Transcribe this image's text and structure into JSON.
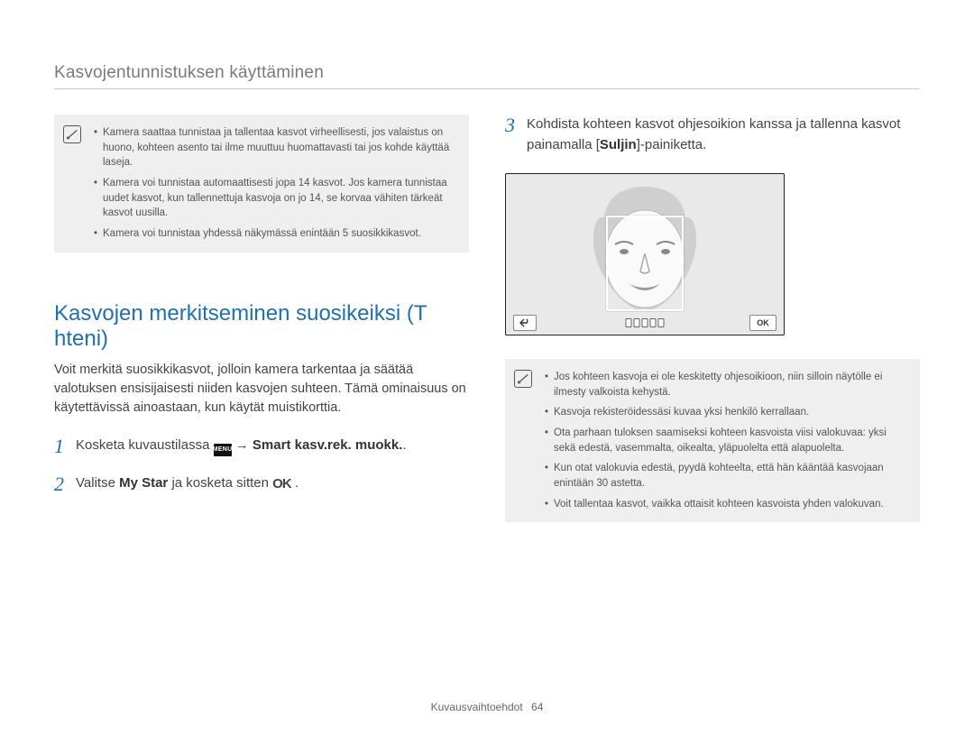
{
  "header": "Kasvojentunnistuksen käyttäminen",
  "notesTop": [
    "Kamera saattaa tunnistaa ja tallentaa kasvot virheellisesti, jos valaistus on huono, kohteen asento tai ilme muuttuu huomattavasti tai jos kohde käyttää laseja.",
    "Kamera voi tunnistaa automaattisesti jopa 14 kasvot. Jos kamera tunnistaa uudet kasvot, kun tallennettuja kasvoja on jo 14, se korvaa vähiten tärkeät kasvot uusilla.",
    "Kamera voi tunnistaa yhdessä näkymässä enintään 5 suosikkikasvot."
  ],
  "section": {
    "title": "Kasvojen merkitseminen suosikeiksi (T  hteni)",
    "intro": "Voit merkitä suosikkikasvot, jolloin kamera tarkentaa ja säätää valotuksen ensisijaisesti niiden kasvojen suhteen. Tämä ominaisuus on käytettävissä ainoastaan, kun käytät muistikorttia."
  },
  "steps": {
    "s1": {
      "num": "1",
      "pre": "Kosketa kuvaustilassa ",
      "menu": "MENU",
      "arrow": " → ",
      "bold": "Smart kasv.rek. muokk.",
      "post": "."
    },
    "s2": {
      "num": "2",
      "pre": "Valitse ",
      "bold": "My Star",
      "mid": " ja kosketa sitten ",
      "icon": "OK",
      "post": "."
    },
    "s3": {
      "num": "3",
      "pre": "Kohdista kohteen kasvot ohjesoikion kanssa ja tallenna kasvot painamalla [",
      "bold": "Suljin",
      "post": "]-painiketta."
    }
  },
  "viewfinder": {
    "okLabel": "OK"
  },
  "notesBottom": [
    "Jos kohteen kasvoja ei ole keskitetty ohjesoikioon, niin silloin näytölle ei ilmesty valkoista kehystä.",
    "Kasvoja rekisteröidessäsi kuvaa yksi henkilö kerrallaan.",
    "Ota parhaan tuloksen saamiseksi kohteen kasvoista viisi valokuvaa: yksi sekä edestä, vasemmalta, oikealta, yläpuolelta että alapuolelta.",
    "Kun otat valokuvia edestä, pyydä kohteelta, että hän kääntää kasvojaan enintään 30 astetta.",
    "Voit tallentaa kasvot, vaikka ottaisit kohteen kasvoista yhden valokuvan."
  ],
  "footer": {
    "label": "Kuvausvaihtoehdot",
    "page": "64"
  },
  "chart_data": null
}
